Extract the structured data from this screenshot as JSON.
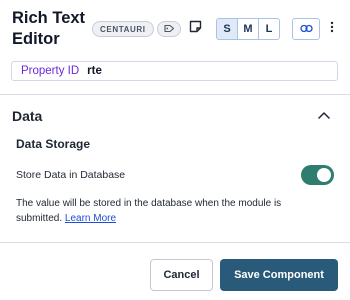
{
  "header": {
    "title": "Rich Text Editor",
    "badge": "CENTAURI",
    "icons": [
      "tag-icon",
      "note-icon",
      "link-icon",
      "kebab-menu-icon"
    ],
    "size_options": [
      "S",
      "M",
      "L"
    ],
    "selected_size": "S"
  },
  "property": {
    "label": "Property ID",
    "value": "rte"
  },
  "section": {
    "title": "Data",
    "expanded": true,
    "subsection_title": "Data Storage",
    "toggle_label": "Store Data in Database",
    "toggle_on": true,
    "help_text": "The value will be stored in the database when the module is submitted.",
    "help_link": "Learn More"
  },
  "footer": {
    "cancel_label": "Cancel",
    "save_label": "Save Component"
  },
  "colors": {
    "accent": "#2a5a79",
    "toggle": "#2e7d6f",
    "property_label": "#6d28d9",
    "link": "#1d4ed8"
  }
}
